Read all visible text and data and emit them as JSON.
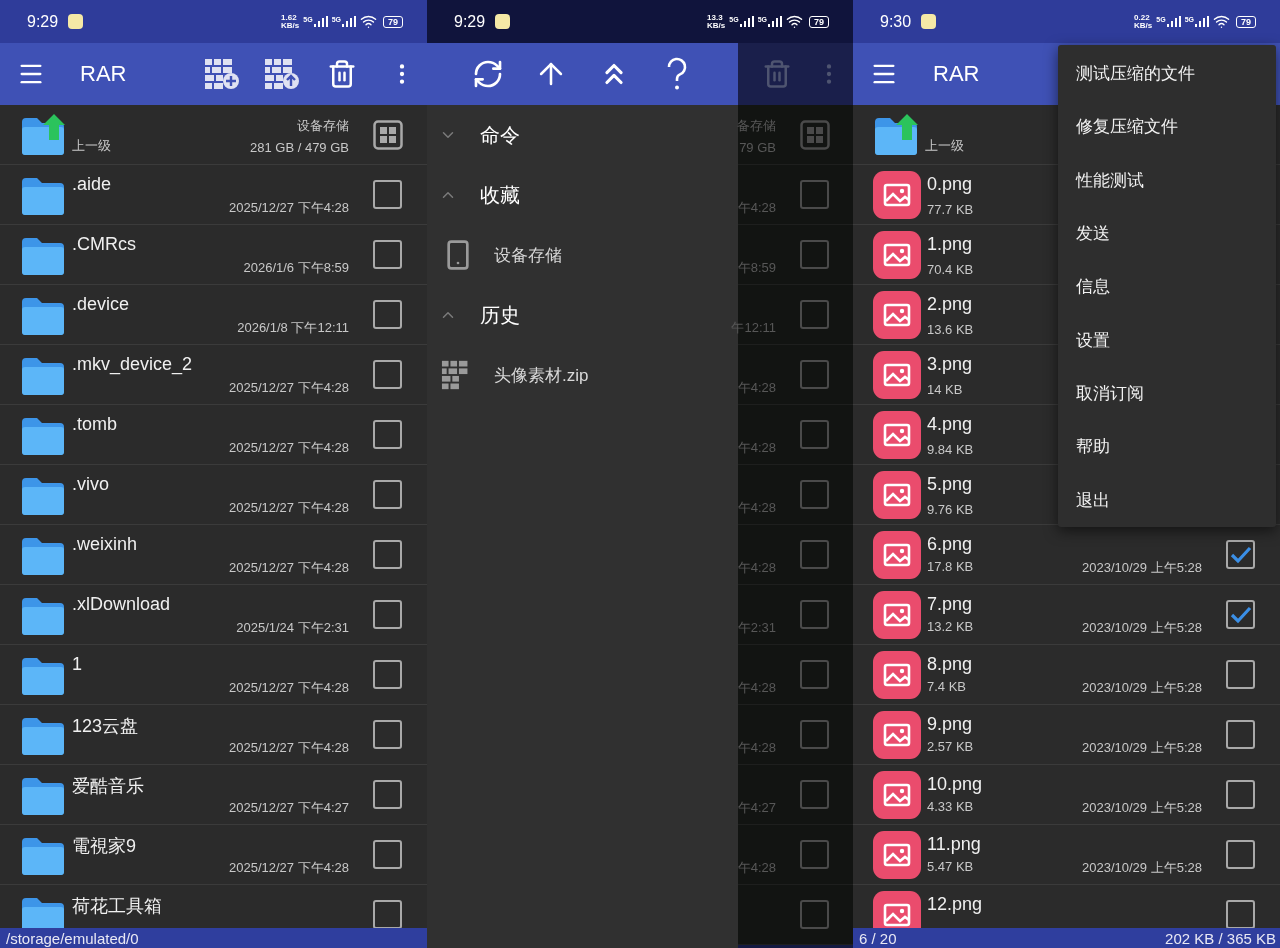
{
  "left_screen": {
    "status_bar": {
      "time": "9:29",
      "net_speed": "1.62",
      "net_unit": "KB/s",
      "network_types": [
        "5G",
        "5G"
      ],
      "battery": "79"
    },
    "toolbar": {
      "title": "RAR"
    },
    "parent_row": {
      "label": "上一级",
      "storage_name": "设备存储",
      "storage_size": "281 GB / 479 GB"
    },
    "rows": [
      {
        "name": ".aide",
        "date": "2025/12/27 下午4:28",
        "checked": false
      },
      {
        "name": ".CMRcs",
        "date": "2026/1/6 下午8:59",
        "checked": false
      },
      {
        "name": ".device",
        "date": "2026/1/8 下午12:11",
        "checked": false
      },
      {
        "name": ".mkv_device_2",
        "date": "2025/12/27 下午4:28",
        "checked": false
      },
      {
        "name": ".tomb",
        "date": "2025/12/27 下午4:28",
        "checked": false
      },
      {
        "name": ".vivo",
        "date": "2025/12/27 下午4:28",
        "checked": false
      },
      {
        "name": ".weixinh",
        "date": "2025/12/27 下午4:28",
        "checked": false
      },
      {
        "name": ".xlDownload",
        "date": "2025/1/24 下午2:31",
        "checked": false
      },
      {
        "name": "1",
        "date": "2025/12/27 下午4:28",
        "checked": false
      },
      {
        "name": "123云盘",
        "date": "2025/12/27 下午4:28",
        "checked": false
      },
      {
        "name": "爱酷音乐",
        "date": "2025/12/27 下午4:27",
        "checked": false
      },
      {
        "name": "電視家9",
        "date": "2025/12/27 下午4:28",
        "checked": false
      },
      {
        "name": "荷花工具箱",
        "checked": false
      }
    ],
    "footer": {
      "path": "/storage/emulated/0"
    }
  },
  "middle_screen": {
    "status_bar": {
      "time": "9:29",
      "net_speed": "13.3",
      "net_unit": "KB/s",
      "network_types": [
        "5G",
        "5G"
      ],
      "battery": "79"
    },
    "drawer": {
      "sections": [
        {
          "title": "命令",
          "expanded": false
        },
        {
          "title": "收藏",
          "expanded": true,
          "items": [
            {
              "kind": "storage",
              "label": "设备存储"
            }
          ]
        },
        {
          "title": "历史",
          "expanded": true,
          "items": [
            {
              "kind": "archive",
              "label": "头像素材.zip"
            }
          ]
        }
      ]
    },
    "background": {
      "storage_name": "备存储",
      "storage_size": "79 GB",
      "rows": [
        {
          "date": "午4:28",
          "checked": false
        },
        {
          "date": "午8:59",
          "checked": false
        },
        {
          "date": "午12:11",
          "checked": false
        },
        {
          "date": "午4:28",
          "checked": false
        },
        {
          "date": "午4:28",
          "checked": false
        },
        {
          "date": "午4:28",
          "checked": false
        },
        {
          "date": "午4:28",
          "checked": false
        },
        {
          "date": "午2:31",
          "checked": false
        },
        {
          "date": "午4:28",
          "checked": false
        },
        {
          "date": "午4:28",
          "checked": false
        },
        {
          "date": "午4:27",
          "checked": false
        },
        {
          "date": "午4:28",
          "checked": false
        },
        {
          "checked": false
        }
      ]
    }
  },
  "right_screen": {
    "status_bar": {
      "time": "9:30",
      "net_speed": "0.22",
      "net_unit": "KB/s",
      "network_types": [
        "5G",
        "5G"
      ],
      "battery": "79"
    },
    "toolbar": {
      "title": "RAR"
    },
    "parent_row": {
      "label": "上一级"
    },
    "rows": [
      {
        "name": "0.png",
        "size": "77.7 KB"
      },
      {
        "name": "1.png",
        "size": "70.4 KB"
      },
      {
        "name": "2.png",
        "size": "13.6 KB"
      },
      {
        "name": "3.png",
        "size": "14 KB"
      },
      {
        "name": "4.png",
        "size": "9.84 KB"
      },
      {
        "name": "5.png",
        "size": "9.76 KB"
      },
      {
        "name": "6.png",
        "size": "17.8 KB",
        "date": "2023/10/29 上午5:28",
        "checked": true
      },
      {
        "name": "7.png",
        "size": "13.2 KB",
        "date": "2023/10/29 上午5:28",
        "checked": true
      },
      {
        "name": "8.png",
        "size": "7.4 KB",
        "date": "2023/10/29 上午5:28",
        "checked": false
      },
      {
        "name": "9.png",
        "size": "2.57 KB",
        "date": "2023/10/29 上午5:28",
        "checked": false
      },
      {
        "name": "10.png",
        "size": "4.33 KB",
        "date": "2023/10/29 上午5:28",
        "checked": false
      },
      {
        "name": "11.png",
        "size": "5.47 KB",
        "date": "2023/10/29 上午5:28",
        "checked": false
      },
      {
        "name": "12.png",
        "checked": false
      }
    ],
    "menu": {
      "items": [
        "测试压缩的文件",
        "修复压缩文件",
        "性能测试",
        "发送",
        "信息",
        "设置",
        "取消订阅",
        "帮助",
        "退出"
      ]
    },
    "footer": {
      "selection": "6 / 20",
      "size": "202 KB / 365 KB"
    }
  }
}
